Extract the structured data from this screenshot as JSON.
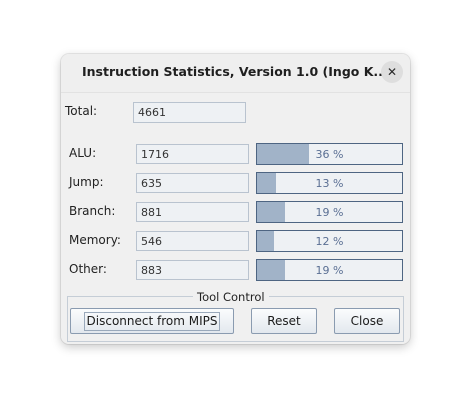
{
  "window": {
    "title": "Instruction Statistics, Version 1.0 (Ingo K...",
    "close_icon": "close-icon"
  },
  "total": {
    "label": "Total:",
    "value": "4661"
  },
  "stats": [
    {
      "label": "ALU:",
      "value": "1716",
      "percent_text": "36 %",
      "fraction": 0.36
    },
    {
      "label": "Jump:",
      "value": "635",
      "percent_text": "13 %",
      "fraction": 0.13
    },
    {
      "label": "Branch:",
      "value": "881",
      "percent_text": "19 %",
      "fraction": 0.19
    },
    {
      "label": "Memory:",
      "value": "546",
      "percent_text": "12 %",
      "fraction": 0.12
    },
    {
      "label": "Other:",
      "value": "883",
      "percent_text": "19 %",
      "fraction": 0.19
    }
  ],
  "tool_control": {
    "title": "Tool Control",
    "disconnect_label": "Disconnect from MIPS",
    "reset_label": "Reset",
    "close_label": "Close"
  },
  "colors": {
    "bar_fill": "#a1b3c8",
    "bar_border": "#4e6582",
    "percent_text": "#5a6f93"
  }
}
